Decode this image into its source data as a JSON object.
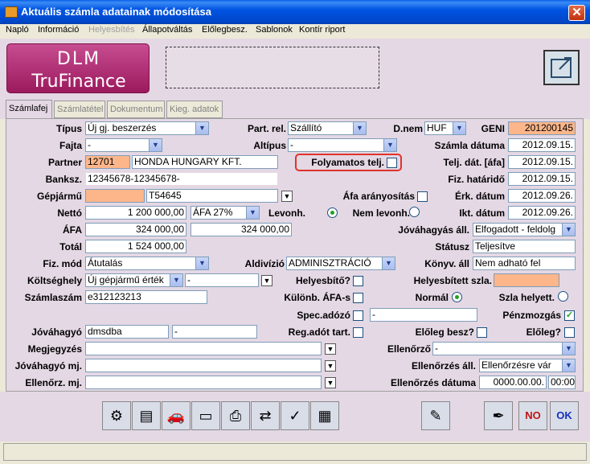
{
  "window": {
    "title": "Aktuális számla adatainak módosítása",
    "close_label": "✕"
  },
  "menu": [
    "Napló",
    "Információ",
    "Helyesbítés",
    "Állapotváltás",
    "Előlegbesz.",
    "Sablonok",
    "Kontír riport"
  ],
  "logo": {
    "line1": "DLM",
    "line2": "TruFinance"
  },
  "tabs": [
    "Számlafej",
    "Számlatétel",
    "Dokumentum",
    "Kieg. adatok"
  ],
  "form": {
    "tipus": {
      "label": "Típus",
      "value": "Új gj. beszerzés"
    },
    "part_rel": {
      "label": "Part. rel.",
      "value": "Szállító"
    },
    "dnem": {
      "label": "D.nem",
      "value": "HUF"
    },
    "geni": {
      "label": "GENI",
      "value": "201200145"
    },
    "fajta": {
      "label": "Fajta",
      "value": "-"
    },
    "altipus": {
      "label": "Altípus",
      "value": "-"
    },
    "szamla_datuma": {
      "label": "Számla dátuma",
      "value": "2012.09.15."
    },
    "partner": {
      "label": "Partner",
      "code": "12701",
      "name": "HONDA HUNGARY KFT."
    },
    "folyamatos_telj": {
      "label": "Folyamatos telj."
    },
    "telj_dat": {
      "label": "Telj. dát. [áfa]",
      "value": "2012.09.15."
    },
    "banksz": {
      "label": "Banksz.",
      "value": "12345678-12345678-"
    },
    "fiz_hatarido": {
      "label": "Fiz. határidő",
      "value": "2012.09.15."
    },
    "gepjarmu": {
      "label": "Gépjármű",
      "value": "",
      "plate": "T54645"
    },
    "afa_aranyositas": {
      "label": "Áfa arányosítás"
    },
    "erk_datum": {
      "label": "Érk. dátum",
      "value": "2012.09.26."
    },
    "netto": {
      "label": "Nettó",
      "value": "1 200 000,00",
      "afa_rate": "ÁFA 27%"
    },
    "levonh": {
      "label": "Levonh."
    },
    "nem_levonh": {
      "label": "Nem levonh."
    },
    "ikt_datum": {
      "label": "Ikt. dátum",
      "value": "2012.09.26."
    },
    "afa": {
      "label": "ÁFA",
      "value": "324 000,00",
      "value2": "324 000,00"
    },
    "jovahagyas_all": {
      "label": "Jóváhagyás áll.",
      "value": "Elfogadott - feldolg"
    },
    "total": {
      "label": "Totál",
      "value": "1 524 000,00"
    },
    "statusz": {
      "label": "Státusz",
      "value": "Teljesítve"
    },
    "fiz_mod": {
      "label": "Fiz. mód",
      "value": "Átutalás"
    },
    "aldivizio": {
      "label": "Aldivízió",
      "value": "ADMINISZTRÁCIÓ"
    },
    "konyv_all": {
      "label": "Könyv. áll",
      "value": "Nem adható fel"
    },
    "koltseghely": {
      "label": "Költséghely",
      "value": "Új gépjármű érték",
      "value2": "-"
    },
    "helyesbito": {
      "label": "Helyesbítő?"
    },
    "helyesbitett_szla": {
      "label": "Helyesbített szla.",
      "value": ""
    },
    "szamlaszam": {
      "label": "Számlaszám",
      "value": "e312123213"
    },
    "kulonb_afa": {
      "label": "Különb. ÁFA-s"
    },
    "normal": {
      "label": "Normál"
    },
    "szla_helyett": {
      "label": "Szla helyett."
    },
    "spec_adozo": {
      "label": "Spec.adózó",
      "value": "-"
    },
    "penzmozgas": {
      "label": "Pénzmozgás",
      "checked": "✓"
    },
    "jovahagyo": {
      "label": "Jóváhagyó",
      "value": "dmsdba",
      "value2": "-"
    },
    "reg_adot_tart": {
      "label": "Reg.adót tart."
    },
    "eloleg_besz": {
      "label": "Előleg besz?"
    },
    "eloleg": {
      "label": "Előleg?"
    },
    "megjegyzes": {
      "label": "Megjegyzés",
      "value": ""
    },
    "ellenorzo": {
      "label": "Ellenőrző",
      "value": "-"
    },
    "jovahagyo_mj": {
      "label": "Jóváhagyó mj.",
      "value": ""
    },
    "ellenorzes_all": {
      "label": "Ellenőrzés áll.",
      "value": "Ellenőrzésre vár"
    },
    "ellenorz_mj": {
      "label": "Ellenőrz. mj.",
      "value": ""
    },
    "ellenorzes_datuma": {
      "label": "Ellenőrzés dátuma",
      "date": "0000.00.00.",
      "time": "00:00"
    }
  },
  "toolbar": {
    "no_label": "NO",
    "ok_label": "OK"
  },
  "colors": {
    "accent_orange": "#fdb68a",
    "highlight": "#e0322a",
    "panel": "#e4d8e4"
  }
}
